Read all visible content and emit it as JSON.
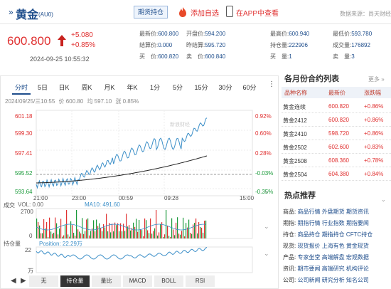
{
  "header": {
    "title": "黄金",
    "code": "(AU0)",
    "position_button": "期货持仓",
    "add_favorite": "添加自选",
    "view_in_app": "在APP中查看",
    "source": "数据来源：尚天财经"
  },
  "quote": {
    "price": "600.800",
    "change": "+5.080",
    "change_pct": "+0.85%",
    "timestamp": "2024-09-25 10:55:32",
    "fields": [
      {
        "label": "最新价:",
        "value": "600.800"
      },
      {
        "label": "开盘价:",
        "value": "594.200"
      },
      {
        "label": "最高价:",
        "value": "600.940"
      },
      {
        "label": "最低价:",
        "value": "593.780"
      },
      {
        "label": "结算价:",
        "value": "0.000"
      },
      {
        "label": "昨结算:",
        "value": "595.720"
      },
      {
        "label": "持仓量:",
        "value": "222906"
      },
      {
        "label": "成交量:",
        "value": "176892"
      },
      {
        "label": "买　价:",
        "value": "600.820"
      },
      {
        "label": "卖　价:",
        "value": "600.840"
      },
      {
        "label": "买　量:",
        "value": "1"
      },
      {
        "label": "卖　量:",
        "value": "3"
      }
    ]
  },
  "chart": {
    "tabs": [
      "分时",
      "5日",
      "日K",
      "周K",
      "月K",
      "年K",
      "1分",
      "5分",
      "15分",
      "30分",
      "60分"
    ],
    "active_tab": "分时",
    "info": [
      "2024/09/25/三10:55",
      "价 600.80",
      "均 597.10",
      "涨 0.85%"
    ],
    "y_left": [
      "601.18",
      "599.30",
      "597.41",
      "595.52",
      "593.64"
    ],
    "y_right": [
      "0.92%",
      "0.60%",
      "0.28%",
      "-0.03%",
      "-0.35%"
    ],
    "x_labels": [
      "21:00",
      "23:00",
      "00:59",
      "09:28",
      "15:00"
    ],
    "volume_label": "成交",
    "vol": "VOL: 0.00",
    "ma10": "MA10: 491.60",
    "vol_axis": [
      "2700",
      "0"
    ],
    "position_label": "持仓量",
    "position": "Position: 22.29万",
    "pos_axis_top": "22",
    "pos_axis_unit": "万",
    "bottom_tabs": [
      "无",
      "持仓量",
      "量比",
      "MACD",
      "BOLL",
      "RSI"
    ],
    "active_bottom_tab": "持仓量",
    "watermark": "新浪财经"
  },
  "futures": {
    "title": "各月份合约列表",
    "more": "更多 »",
    "columns": [
      "品种名称",
      "最新价",
      "涨跌幅"
    ],
    "rows": [
      {
        "name": "黄金连续",
        "price": "600.820",
        "pct": "+0.86%"
      },
      {
        "name": "黄金2412",
        "price": "600.820",
        "pct": "+0.86%"
      },
      {
        "name": "黄金2410",
        "price": "598.720",
        "pct": "+0.86%"
      },
      {
        "name": "黄金2502",
        "price": "602.600",
        "pct": "+0.83%"
      },
      {
        "name": "黄金2508",
        "price": "608.360",
        "pct": "+0.78%"
      },
      {
        "name": "黄金2504",
        "price": "604.380",
        "pct": "+0.84%"
      }
    ]
  },
  "hot": {
    "title": "热点推荐",
    "rows": [
      {
        "label": "商品:",
        "links": [
          "商品行情",
          "外盘期货",
          "期货资讯"
        ]
      },
      {
        "label": "期指:",
        "links": [
          "期指行情",
          "行业指数",
          "期指要闻"
        ]
      },
      {
        "label": "持仓:",
        "links": [
          "商品持仓",
          "期指持仓",
          "CFTC持仓"
        ]
      },
      {
        "label": "现货:",
        "links": [
          "现货报价",
          "上海有色",
          "黄金现货"
        ]
      },
      {
        "label": "产品:",
        "links": [
          "专家坐堂",
          "高端解盘",
          "宏观数据"
        ]
      },
      {
        "label": "资讯:",
        "links": [
          "期市要闻",
          "高端研究",
          "机构评论"
        ]
      },
      {
        "label": "公司:",
        "links": [
          "公司新闻",
          "研究分析",
          "知名公司"
        ]
      }
    ]
  },
  "colors": {
    "up": "#e03030",
    "down": "#1a9a3a",
    "brand": "#1f4e8c",
    "line": "#3c8fc8"
  }
}
